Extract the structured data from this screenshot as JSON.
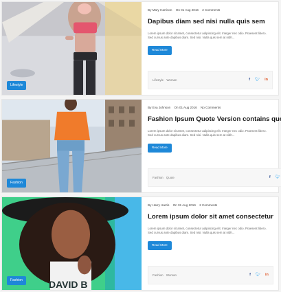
{
  "posts": [
    {
      "category": "Lifestyle",
      "author": "By Mary Harrison",
      "date": "On 01 Aug 2016",
      "comments": "2 Comments",
      "title": "Dapibus diam sed nisi nulla quis sem",
      "excerpt_line1": "Lorem ipsum dolor sit amet, consectetur adipiscing elit. Integer nec odio. Praesent libero.",
      "excerpt_line2": "Sed cursus ante dapibus diam. Sed nisi. Nulla quis sem at nibh...",
      "read_more": "Read More",
      "tags": [
        "Lifestyle",
        "Woman"
      ]
    },
    {
      "category": "Fashion",
      "author": "By Eva Johnson",
      "date": "On 01 Aug 2016",
      "comments": "No Comments",
      "title": "Fashion Ipsum Quote Version contains quotes",
      "excerpt_line1": "Lorem ipsum dolor sit amet, consectetur adipiscing elit. Integer nec odio. Praesent libero.",
      "excerpt_line2": "Sed cursus ante dapibus diam. Sed nisi. Nulla quis sem at nibh...",
      "read_more": "Read More",
      "tags": [
        "Fashion",
        "Quote"
      ]
    },
    {
      "category": "Fashion",
      "author": "By Harry Harris",
      "date": "On 01 Aug 2016",
      "comments": "2 Comments",
      "title": "Lorem ipsum dolor sit amet consectetur",
      "excerpt_line1": "Lorem ipsum dolor sit amet, consectetur adipiscing elit. Integer nec odio. Praesent libero.",
      "excerpt_line2": "Sed cursus ante dapibus diam. Sed nisi. Nulla quis sem at nibh...",
      "read_more": "Read More",
      "tags": [
        "Fashion",
        "Woman"
      ]
    }
  ],
  "social_icons": [
    "facebook-icon",
    "twitter-icon",
    "linkedin-icon"
  ],
  "colors": {
    "accent": "#1e88d8",
    "facebook": "#3b5998",
    "twitter": "#1da1f2",
    "linkedin": "#e05a2b"
  }
}
